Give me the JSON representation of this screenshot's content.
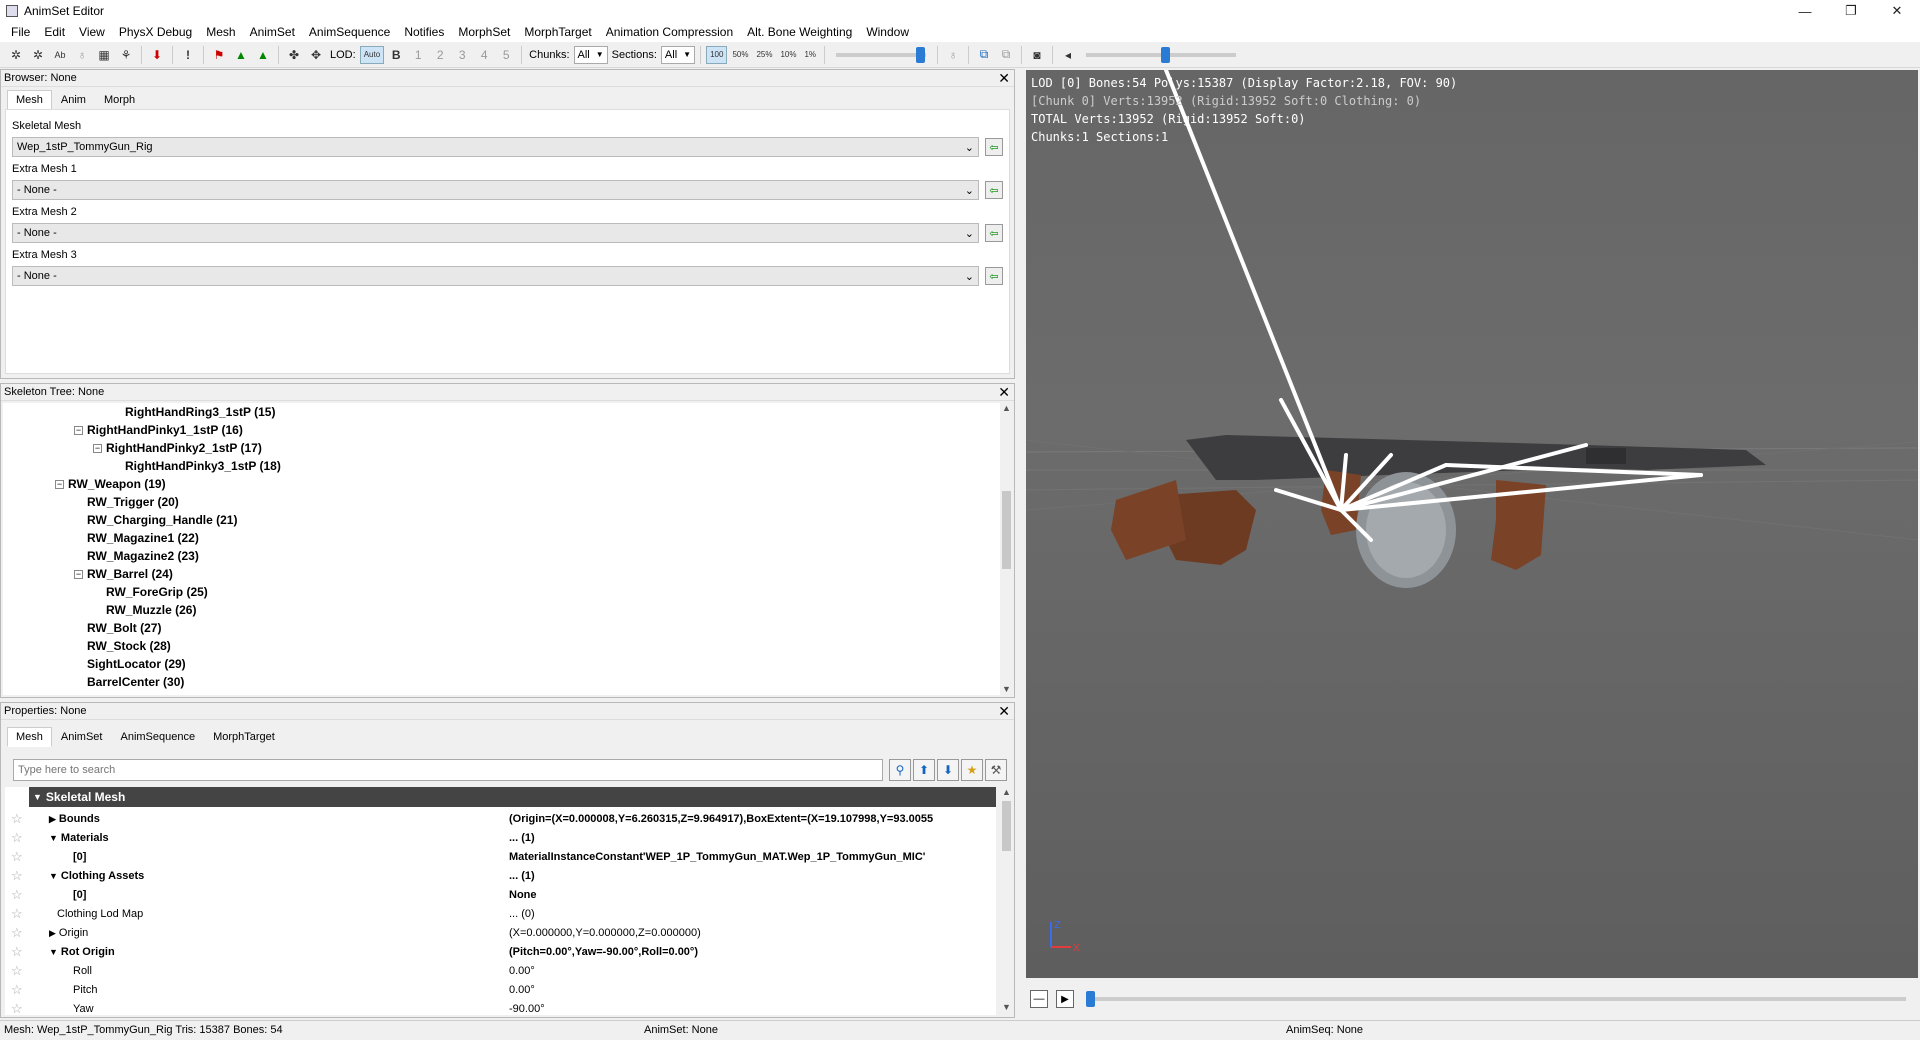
{
  "window": {
    "title": "AnimSet Editor",
    "minimize": "—",
    "restore": "❐",
    "close": "✕"
  },
  "menu": [
    "File",
    "Edit",
    "View",
    "PhysX Debug",
    "Mesh",
    "AnimSet",
    "AnimSequence",
    "Notifies",
    "MorphSet",
    "MorphTarget",
    "Animation Compression",
    "Alt. Bone Weighting",
    "Window"
  ],
  "toolbar": {
    "lod_label": "LOD:",
    "lod_auto": "Auto",
    "lod_base": "B",
    "lod_levels": [
      "1",
      "2",
      "3",
      "4",
      "5"
    ],
    "chunks_label": "Chunks:",
    "chunks_value": "All",
    "sections_label": "Sections:",
    "sections_value": "All",
    "speeds": [
      "100",
      "50%",
      "25%",
      "10%",
      "1%"
    ]
  },
  "browser": {
    "title": "Browser: None",
    "close": "✕",
    "tabs": [
      "Mesh",
      "Anim",
      "Morph"
    ],
    "fields": [
      {
        "label": "Skeletal Mesh",
        "value": "Wep_1stP_TommyGun_Rig"
      },
      {
        "label": "Extra Mesh 1",
        "value": "- None -"
      },
      {
        "label": "Extra Mesh 2",
        "value": "- None -"
      },
      {
        "label": "Extra Mesh 3",
        "value": "- None -"
      }
    ]
  },
  "skeleton": {
    "title": "Skeleton Tree: None",
    "close": "✕",
    "nodes": [
      {
        "label": "RightHandRing3_1stP (15)",
        "depth": 3,
        "toggle": ""
      },
      {
        "label": "RightHandPinky1_1stP (16)",
        "depth": 1,
        "toggle": "−"
      },
      {
        "label": "RightHandPinky2_1stP (17)",
        "depth": 2,
        "toggle": "−"
      },
      {
        "label": "RightHandPinky3_1stP (18)",
        "depth": 3,
        "toggle": ""
      },
      {
        "label": "RW_Weapon (19)",
        "depth": 0,
        "toggle": "−"
      },
      {
        "label": "RW_Trigger (20)",
        "depth": 1,
        "toggle": ""
      },
      {
        "label": "RW_Charging_Handle (21)",
        "depth": 1,
        "toggle": ""
      },
      {
        "label": "RW_Magazine1 (22)",
        "depth": 1,
        "toggle": ""
      },
      {
        "label": "RW_Magazine2 (23)",
        "depth": 1,
        "toggle": ""
      },
      {
        "label": "RW_Barrel (24)",
        "depth": 1,
        "toggle": "−"
      },
      {
        "label": "RW_ForeGrip (25)",
        "depth": 2,
        "toggle": ""
      },
      {
        "label": "RW_Muzzle (26)",
        "depth": 2,
        "toggle": ""
      },
      {
        "label": "RW_Bolt (27)",
        "depth": 1,
        "toggle": ""
      },
      {
        "label": "RW_Stock (28)",
        "depth": 1,
        "toggle": ""
      },
      {
        "label": "SightLocator (29)",
        "depth": 1,
        "toggle": ""
      },
      {
        "label": "BarrelCenter (30)",
        "depth": 1,
        "toggle": ""
      }
    ]
  },
  "properties": {
    "title": "Properties: None",
    "close": "✕",
    "tabs": [
      "Mesh",
      "AnimSet",
      "AnimSequence",
      "MorphTarget"
    ],
    "search_placeholder": "Type here to search",
    "category": "Skeletal Mesh",
    "rows": [
      {
        "name": "Bounds",
        "value": "(Origin=(X=0.000008,Y=6.260315,Z=9.964917),BoxExtent=(X=19.107998,Y=93.0055",
        "bold": true,
        "arrow": "▶",
        "indent": 0
      },
      {
        "name": "Materials",
        "value": "... (1)",
        "bold": true,
        "arrow": "▼",
        "indent": 0
      },
      {
        "name": "[0]",
        "value": "MaterialInstanceConstant'WEP_1P_TommyGun_MAT.Wep_1P_TommyGun_MIC'",
        "bold": true,
        "arrow": "",
        "indent": 2
      },
      {
        "name": "Clothing Assets",
        "value": "... (1)",
        "bold": true,
        "arrow": "▼",
        "indent": 0
      },
      {
        "name": "[0]",
        "value": "None",
        "bold": true,
        "arrow": "",
        "indent": 2
      },
      {
        "name": "Clothing Lod Map",
        "value": "... (0)",
        "bold": false,
        "arrow": "",
        "indent": 1
      },
      {
        "name": "Origin",
        "value": "(X=0.000000,Y=0.000000,Z=0.000000)",
        "bold": false,
        "arrow": "▶",
        "indent": 0
      },
      {
        "name": "Rot Origin",
        "value": "(Pitch=0.00°,Yaw=-90.00°,Roll=0.00°)",
        "bold": true,
        "arrow": "▼",
        "indent": 0
      },
      {
        "name": "Roll",
        "value": "0.00°",
        "bold": false,
        "arrow": "",
        "indent": 2
      },
      {
        "name": "Pitch",
        "value": "0.00°",
        "bold": false,
        "arrow": "",
        "indent": 2
      },
      {
        "name": "Yaw",
        "value": "-90.00°",
        "bold": false,
        "arrow": "",
        "indent": 2
      }
    ]
  },
  "viewport": {
    "lines": [
      "LOD [0] Bones:54 Polys:15387 (Display Factor:2.18, FOV: 90)",
      " [Chunk 0] Verts:13952 (Rigid:13952 Soft:0 Clothing: 0)",
      "TOTAL Verts:13952 (Rigid:13952 Soft:0)",
      "Chunks:1 Sections:1"
    ]
  },
  "status": {
    "mesh": "Mesh: Wep_1stP_TommyGun_Rig  Tris: 15387  Bones: 54",
    "animset": "AnimSet: None",
    "animseq": "AnimSeq: None"
  }
}
